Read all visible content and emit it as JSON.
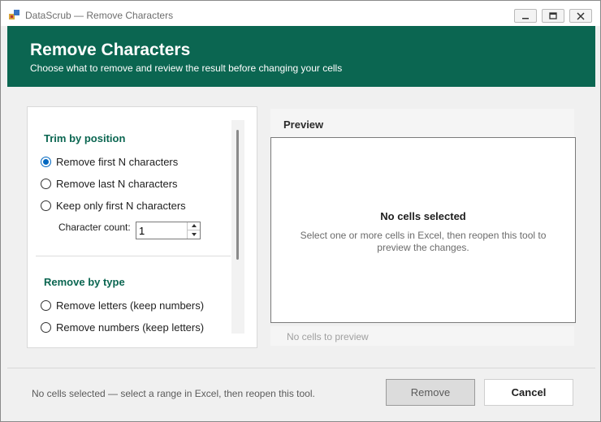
{
  "window": {
    "title": "DataScrub — Remove Characters"
  },
  "header": {
    "title": "Remove Characters",
    "subtitle": "Choose what to remove and review the result before changing your cells",
    "background": "#0b6651"
  },
  "trim_section": {
    "title": "Trim by position",
    "options": [
      {
        "label": "Remove first N characters",
        "checked": true
      },
      {
        "label": "Remove last N characters",
        "checked": false
      },
      {
        "label": "Keep only first N characters",
        "checked": false
      }
    ],
    "count_label": "Character count:",
    "count_value": "1"
  },
  "type_section": {
    "title": "Remove by type",
    "options": [
      {
        "label": "Remove letters (keep numbers)",
        "checked": false
      },
      {
        "label": "Remove numbers (keep letters)",
        "checked": false
      }
    ]
  },
  "preview": {
    "title": "Preview",
    "empty_title": "No cells selected",
    "empty_message": "Select one or more cells in Excel, then reopen this tool to preview the changes.",
    "footer": "No cells to preview"
  },
  "footer": {
    "status": "No cells selected — select a range in Excel, then reopen this tool.",
    "remove_label": "Remove",
    "cancel_label": "Cancel"
  },
  "colors": {
    "accent": "#0b6651",
    "radio_selected": "#0067c0"
  }
}
